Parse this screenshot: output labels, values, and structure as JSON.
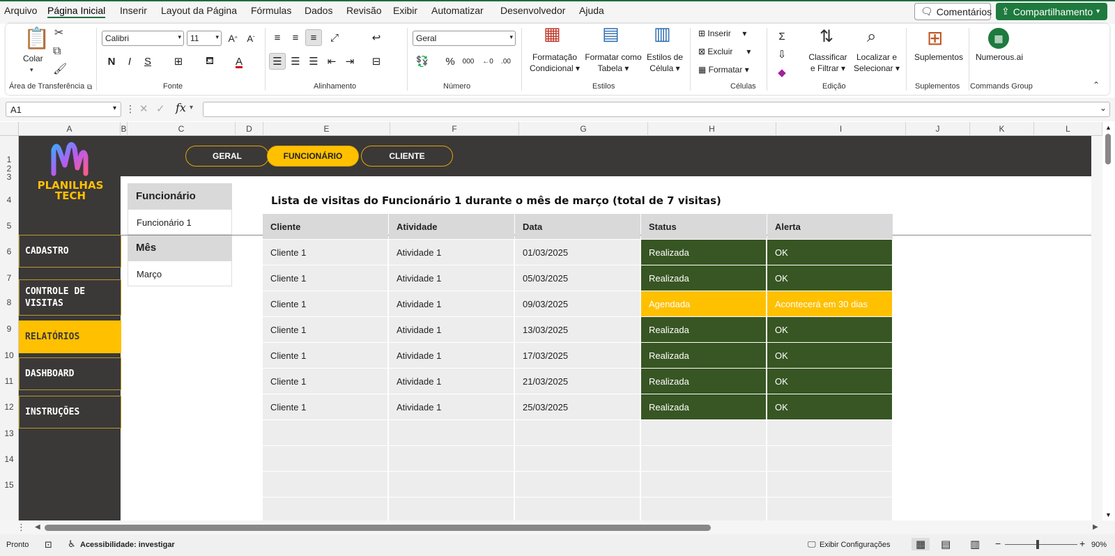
{
  "menu": [
    "Arquivo",
    "Página Inicial",
    "Inserir",
    "Layout da Página",
    "Fórmulas",
    "Dados",
    "Revisão",
    "Exibir",
    "Automatizar",
    "Desenvolvedor",
    "Ajuda"
  ],
  "menu_active_index": 1,
  "comments_label": "Comentários",
  "share_label": "Compartilhamento",
  "ribbon": {
    "paste_label": "Colar",
    "clipboard_group": "Área de Transferência",
    "font_name": "Calibri",
    "font_size": "11",
    "font_group": "Fonte",
    "align_group": "Alinhamento",
    "number_format": "Geral",
    "number_group": "Número",
    "cond_format": [
      "Formatação",
      "Condicional"
    ],
    "format_table": [
      "Formatar como",
      "Tabela"
    ],
    "cell_styles": [
      "Estilos de",
      "Célula"
    ],
    "styles_group": "Estilos",
    "insert_label": "Inserir",
    "delete_label": "Excluir",
    "format_label": "Formatar",
    "cells_group": "Células",
    "sort_filter": [
      "Classificar",
      "e Filtrar"
    ],
    "find_select": [
      "Localizar e",
      "Selecionar"
    ],
    "editing_group": "Edição",
    "addins_label": "Suplementos",
    "addins_group": "Suplementos",
    "numerous_label": "Numerous.ai",
    "commands_group": "Commands Group"
  },
  "namebox": "A1",
  "columns": [
    "A",
    "B",
    "C",
    "D",
    "E",
    "F",
    "G",
    "H",
    "I",
    "J",
    "K",
    "L"
  ],
  "rows": [
    "1",
    "2",
    "3",
    "4",
    "5",
    "6",
    "7",
    "8",
    "9",
    "10",
    "11",
    "12",
    "13",
    "14",
    "15"
  ],
  "logo": {
    "line1": "PLANILHAS",
    "line2": "TECH"
  },
  "nav": [
    "CADASTRO",
    "CONTROLE DE VISITAS",
    "RELATÓRIOS",
    "DASHBOARD",
    "INSTRUÇÕES"
  ],
  "nav_active_index": 2,
  "tabs": [
    "GERAL",
    "FUNCIONÁRIO",
    "CLIENTE"
  ],
  "tab_active_index": 1,
  "filters": {
    "employee_label": "Funcionário",
    "employee_value": "Funcionário 1",
    "month_label": "Mês",
    "month_value": "Março"
  },
  "list_title": "Lista de visitas do Funcionário 1 durante o mês de março (total de 7 visitas)",
  "table": {
    "headers": [
      "Cliente",
      "Atividade",
      "Data",
      "Status",
      "Alerta"
    ],
    "rows": [
      [
        "Cliente 1",
        "Atividade 1",
        "01/03/2025",
        "Realizada",
        "OK"
      ],
      [
        "Cliente 1",
        "Atividade 1",
        "05/03/2025",
        "Realizada",
        "OK"
      ],
      [
        "Cliente 1",
        "Atividade 1",
        "09/03/2025",
        "Agendada",
        "Acontecerá em 30 dias"
      ],
      [
        "Cliente 1",
        "Atividade 1",
        "13/03/2025",
        "Realizada",
        "OK"
      ],
      [
        "Cliente 1",
        "Atividade 1",
        "17/03/2025",
        "Realizada",
        "OK"
      ],
      [
        "Cliente 1",
        "Atividade 1",
        "21/03/2025",
        "Realizada",
        "OK"
      ],
      [
        "Cliente 1",
        "Atividade 1",
        "25/03/2025",
        "Realizada",
        "OK"
      ]
    ],
    "empty_rows": 4
  },
  "colors": {
    "accent": "#ffc000",
    "dark": "#3b3838",
    "done": "#375623",
    "excel_green": "#1e7a3e"
  },
  "status": {
    "ready": "Pronto",
    "accessibility": "Acessibilidade: investigar",
    "display_settings": "Exibir Configurações",
    "zoom": "90%"
  }
}
